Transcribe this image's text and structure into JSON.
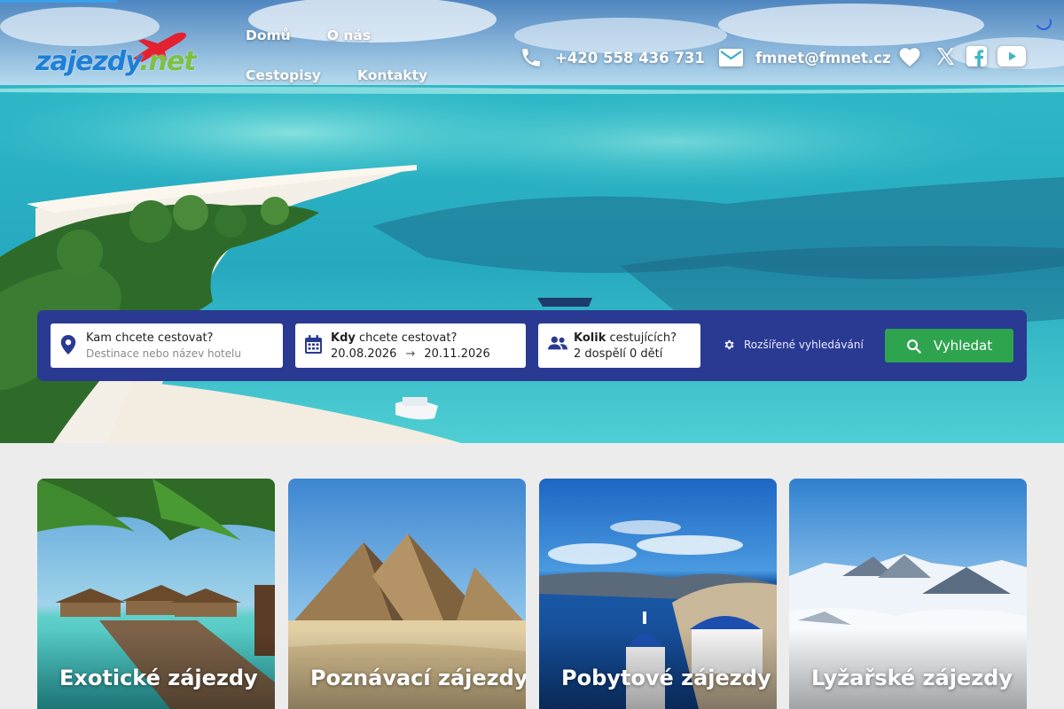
{
  "brand": {
    "part1": "zajezdy",
    "part2": ".net"
  },
  "nav": {
    "items": [
      {
        "label": "Domů"
      },
      {
        "label": "O nás"
      },
      {
        "label": "Cestopisy"
      },
      {
        "label": "Kontakty"
      }
    ]
  },
  "contact": {
    "phone": "+420 558 436 731",
    "email": "fmnet@fmnet.cz"
  },
  "social": {
    "icons": [
      "heart-icon",
      "x-icon",
      "facebook-icon",
      "youtube-icon"
    ]
  },
  "search": {
    "destination": {
      "label": "Kam chcete cestovat?",
      "placeholder": "Destinace nebo název hotelu"
    },
    "dates": {
      "label_bold": "Kdy",
      "label_rest": " chcete cestovat?",
      "from": "20.08.2026",
      "arrow": "→",
      "to": "20.11.2026"
    },
    "travelers": {
      "label_bold": "Kolik",
      "label_rest": " cestujících?",
      "value": "2 dospělí 0 dětí"
    },
    "advanced_label": "Rozšířené vyhledávání",
    "submit_label": "Vyhledat"
  },
  "categories": [
    {
      "title": "Exotické zájezdy"
    },
    {
      "title": "Poznávací zájezdy"
    },
    {
      "title": "Pobytové zájezdy"
    },
    {
      "title": "Lyžařské zájezdy"
    }
  ],
  "colors": {
    "search_bg": "#2a3a92",
    "search_button": "#2ea44f",
    "brand_blue": "#1e7fd6",
    "brand_green": "#7cc142",
    "plane_red": "#e32130"
  }
}
